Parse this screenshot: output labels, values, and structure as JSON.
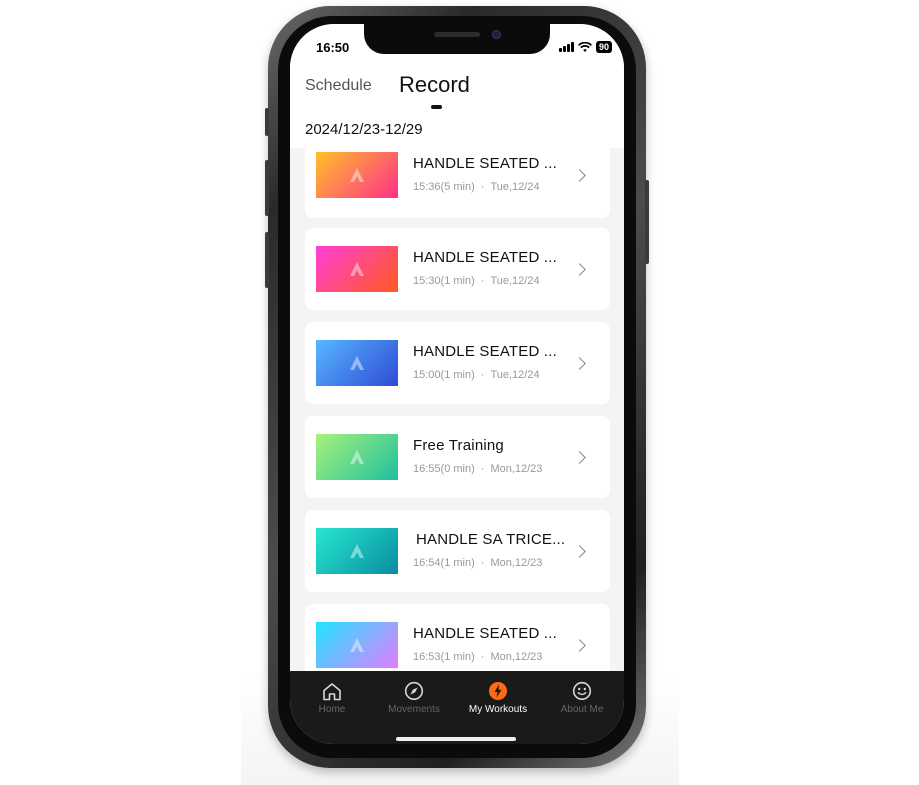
{
  "status_bar": {
    "time": "16:50",
    "battery": "90"
  },
  "header": {
    "tabs": [
      {
        "label": "Schedule",
        "active": false
      },
      {
        "label": "Record",
        "active": true
      }
    ],
    "date_range": "2024/12/23-12/29"
  },
  "workouts": [
    {
      "title": "HANDLE SEATED ...",
      "time": "15:36(5 min)",
      "day": "Tue,12/24",
      "gradient": [
        "#ffc02a",
        "#ff2f8a"
      ]
    },
    {
      "title": "HANDLE SEATED ...",
      "time": "15:30(1 min)",
      "day": "Tue,12/24",
      "gradient": [
        "#ff3fd8",
        "#ff5a20"
      ]
    },
    {
      "title": "HANDLE SEATED ...",
      "time": "15:00(1 min)",
      "day": "Tue,12/24",
      "gradient": [
        "#56b7ff",
        "#2f4ad6"
      ]
    },
    {
      "title": "Free Training",
      "time": "16:55(0 min)",
      "day": "Mon,12/23",
      "gradient": [
        "#a8f27a",
        "#1fbf9f"
      ]
    },
    {
      "title": "HANDLE SA TRICE...",
      "time": "16:54(1 min)",
      "day": "Mon,12/23",
      "gradient": [
        "#27e6cf",
        "#0a8da0"
      ]
    },
    {
      "title": "HANDLE SEATED ...",
      "time": "16:53(1 min)",
      "day": "Mon,12/23",
      "gradient": [
        "#1fe6ff",
        "#e37cff"
      ]
    }
  ],
  "tabbar": {
    "items": [
      {
        "label": "Home",
        "icon": "home-icon",
        "active": false
      },
      {
        "label": "Movements",
        "icon": "compass-icon",
        "active": false
      },
      {
        "label": "My Workouts",
        "icon": "lightning-icon",
        "active": true
      },
      {
        "label": "About Me",
        "icon": "smiley-icon",
        "active": false
      }
    ]
  },
  "colors": {
    "accent": "#ff6a13",
    "tabbar_bg": "#1a1a1a",
    "screen_bg": "#f5f4f3"
  }
}
